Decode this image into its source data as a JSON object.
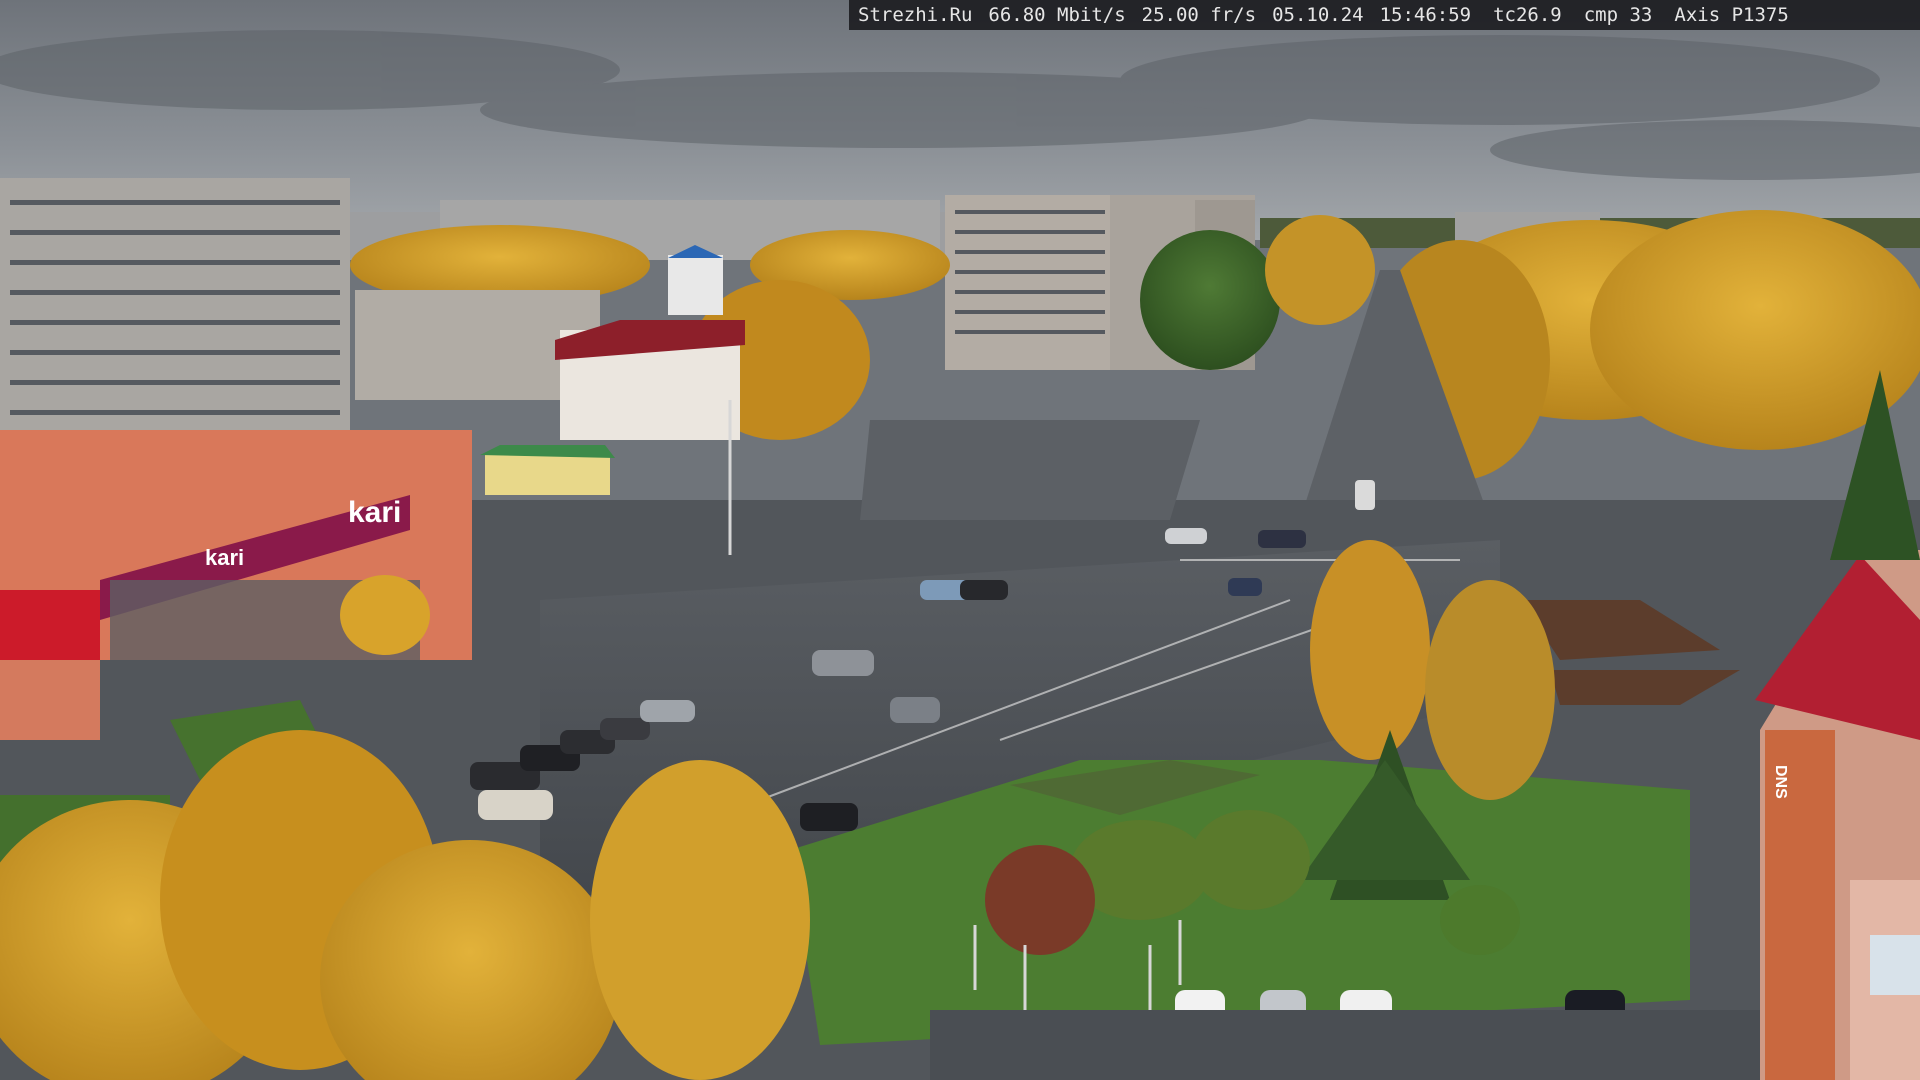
{
  "overlay": {
    "site": "Strezhi.Ru",
    "bitrate": "66.80 Mbit/s",
    "framerate": "25.00 fr/s",
    "date": "05.10.24",
    "time": "15:46:59",
    "tc": "tc26.9",
    "cmp": "cmp 33",
    "camera": "Axis P1375"
  },
  "signs": {
    "store_kari": "kari",
    "store_banner": "kari",
    "store_right": "DNS"
  },
  "colors": {
    "sky": "#8d9298",
    "foliage_gold": "#d8a52a",
    "foliage_green": "#3f6b2a",
    "asphalt": "#4b4f55",
    "store_red": "#8a1a4a",
    "building_red": "#b21f32"
  }
}
